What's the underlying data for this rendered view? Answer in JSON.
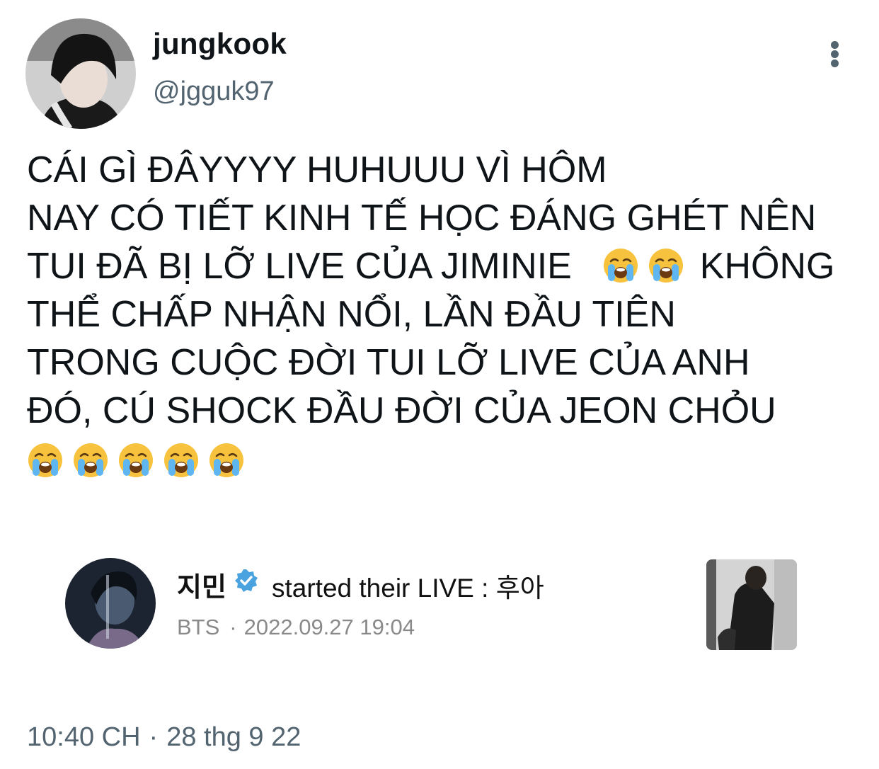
{
  "author": {
    "display_name": "jungkook",
    "handle": "@jgguk97"
  },
  "more_icon": "more-vertical-icon",
  "tweet": {
    "lines": [
      "CÁI GÌ ĐÂYYYY HUHUUU VÌ HÔM",
      "NAY CÓ TIẾT KINH TẾ HỌC ĐÁNG GHÉT NÊN",
      "TUI ĐÃ BỊ LỠ LIVE CỦA JIMINIE",
      "KHÔNG",
      "THỂ CHẤP NHẬN NỔI, LẦN ĐẦU TIÊN",
      "TRONG CUỘC ĐỜI TUI LỠ LIVE CỦA ANH",
      "ĐÓ, CÚ SHOCK ĐẦU ĐỜI CỦA JEON CHỎU"
    ],
    "emoji": "loudly-crying-face",
    "inline_emoji_count": 2,
    "trailing_emoji_count": 5
  },
  "live_card": {
    "name": "지민",
    "message": "started their LIVE : 후아",
    "group": "BTS",
    "separator": "·",
    "datetime": "2022.09.27 19:04",
    "verified_color": "#4aa3df"
  },
  "footer": {
    "time": "10:40 CH",
    "separator": "·",
    "date": "28 thg 9 22"
  },
  "colors": {
    "text": "#0f1419",
    "secondary": "#536471",
    "emoji_face": "#f7c23d"
  }
}
